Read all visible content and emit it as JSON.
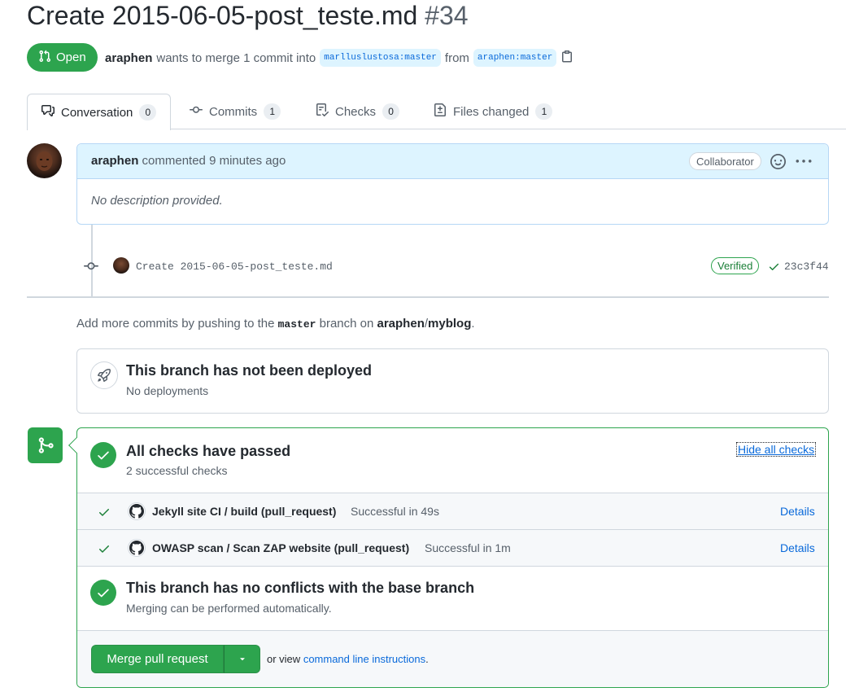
{
  "pr": {
    "title": "Create 2015-06-05-post_teste.md",
    "number": "#34",
    "state": "Open",
    "author": "araphen",
    "merge_text": "wants to merge 1 commit into",
    "base_branch": "marlluslustosa:master",
    "from_text": "from",
    "head_branch": "araphen:master"
  },
  "tabs": [
    {
      "label": "Conversation",
      "count": "0"
    },
    {
      "label": "Commits",
      "count": "1"
    },
    {
      "label": "Checks",
      "count": "0"
    },
    {
      "label": "Files changed",
      "count": "1"
    }
  ],
  "comment": {
    "author": "araphen",
    "action": "commented 9 minutes ago",
    "badge": "Collaborator",
    "body": "No description provided."
  },
  "commit": {
    "message": "Create 2015-06-05-post_teste.md",
    "verified": "Verified",
    "sha": "23c3f44"
  },
  "push_hint": {
    "prefix": "Add more commits by pushing to the",
    "branch": "master",
    "middle": "branch on",
    "owner": "araphen",
    "sep": "/",
    "repo": "myblog",
    "suffix": "."
  },
  "deploy": {
    "title": "This branch has not been deployed",
    "subtitle": "No deployments"
  },
  "checks": {
    "title": "All checks have passed",
    "subtitle": "2 successful checks",
    "hide_label": "Hide all checks",
    "items": [
      {
        "name": "Jekyll site CI / build (pull_request)",
        "status": "Successful in 49s",
        "details": "Details"
      },
      {
        "name": "OWASP scan / Scan ZAP website (pull_request)",
        "status": "Successful in 1m",
        "details": "Details"
      }
    ]
  },
  "conflicts": {
    "title": "This branch has no conflicts with the base branch",
    "subtitle": "Merging can be performed automatically."
  },
  "merge": {
    "button": "Merge pull request",
    "alt_prefix": "or view",
    "alt_link": "command line instructions",
    "alt_suffix": "."
  },
  "colors": {
    "success": "#2da44e",
    "link": "#0969da",
    "muted": "#57606a"
  }
}
